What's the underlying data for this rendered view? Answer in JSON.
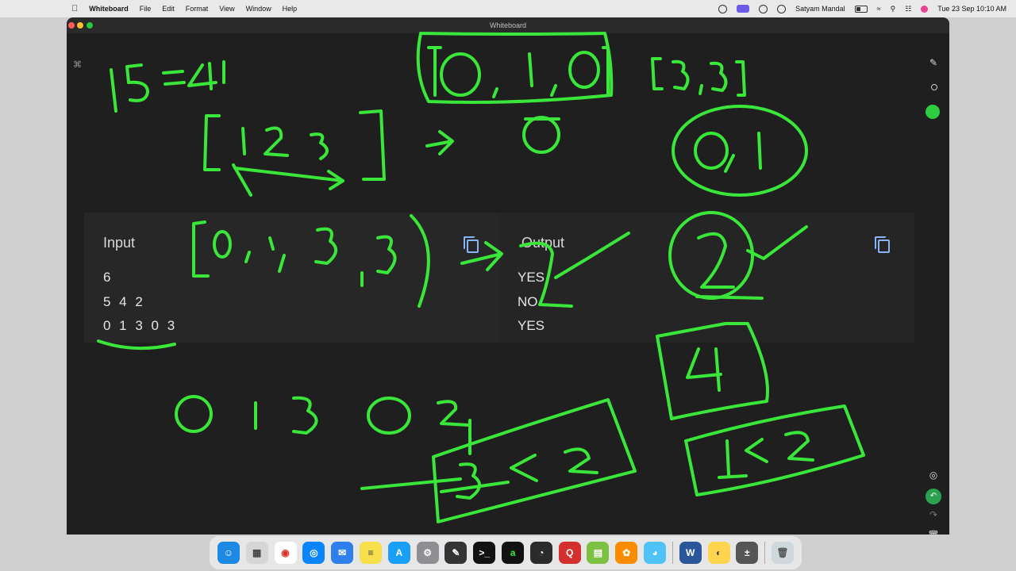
{
  "menubar": {
    "apple_icon": "apple-icon",
    "app_name": "Whiteboard",
    "menus": [
      "File",
      "Edit",
      "Format",
      "View",
      "Window",
      "Help"
    ],
    "user": "Satyam Mandal",
    "datetime": "Tue 23 Sep  10:10 AM"
  },
  "window": {
    "title": "Whiteboard"
  },
  "problem_panel": {
    "input_title": "Input",
    "input_lines": [
      "6",
      "5 4 2",
      "0 1 3 0 3"
    ],
    "output_title": "Output",
    "output_lines": [
      "YES",
      "NO",
      "YES"
    ]
  },
  "toolbar": {
    "pen_icon": "pen-icon",
    "selected_color": "#2ecc40"
  },
  "ink": {
    "color": "#39e639",
    "texts": [
      "1524",
      "[0,1,0]",
      "[3,3]",
      "[123]",
      "0",
      "0,1",
      "[0,1,3,3]",
      "2",
      "4",
      "0 1 3 0 2",
      "3<2",
      "1<2"
    ]
  },
  "dock": {
    "apps": [
      "finder",
      "launchpad",
      "chrome",
      "safari",
      "mail",
      "notes",
      "app-store",
      "system-settings",
      "textedit",
      "terminal",
      "activity",
      "logic",
      "quip",
      "files",
      "photos",
      "messages",
      "word",
      "idea",
      "calculator",
      "trash"
    ]
  }
}
